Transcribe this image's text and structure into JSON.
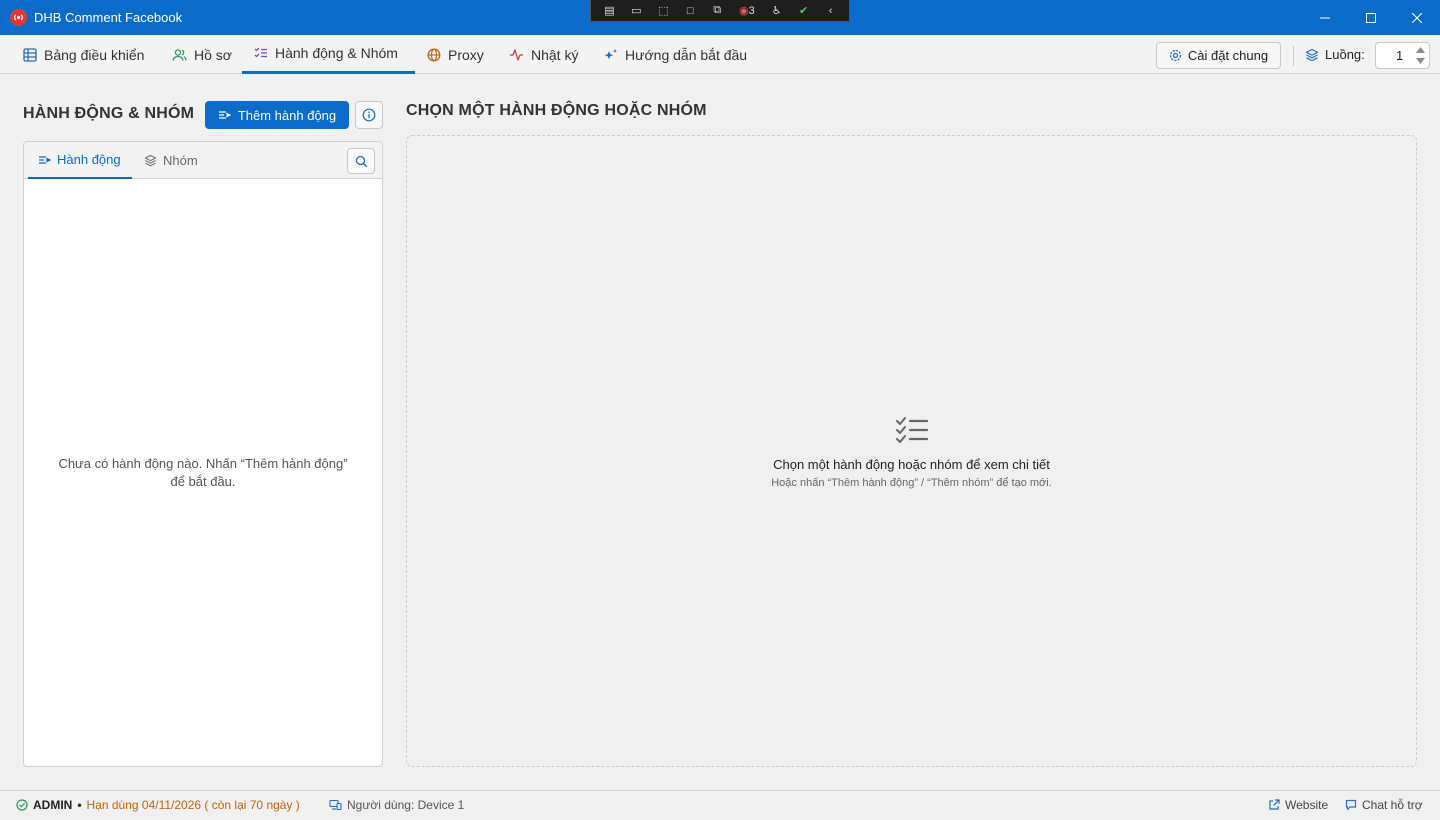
{
  "window": {
    "title": "DHB Comment Facebook",
    "debug_toolbar": {
      "badge_count": "3"
    }
  },
  "tabs": [
    {
      "label": "Bảng điều khiển",
      "icon": "table-icon",
      "active": false
    },
    {
      "label": "Hồ sơ",
      "icon": "users-icon",
      "active": false
    },
    {
      "label": "Hành động & Nhóm",
      "icon": "checklist-icon",
      "active": true
    },
    {
      "label": "Proxy",
      "icon": "globe-icon",
      "active": false
    },
    {
      "label": "Nhật ký",
      "icon": "activity-icon",
      "active": false
    },
    {
      "label": "Hướng dẫn bắt đầu",
      "icon": "sparkles-icon",
      "active": false
    }
  ],
  "toolbar": {
    "settings_label": "Cài đặt chung",
    "threads_label": "Luồng:",
    "threads_value": "1"
  },
  "left": {
    "header": "HÀNH ĐỘNG & NHÓM",
    "add_button_label": "Thêm hành động",
    "subtabs": [
      {
        "label": "Hành động",
        "active": true
      },
      {
        "label": "Nhóm",
        "active": false
      }
    ],
    "empty_text": "Chưa có hành động nào. Nhấn “Thêm hành động” để bắt đầu."
  },
  "right": {
    "header": "CHỌN MỘT HÀNH ĐỘNG HOẶC NHÓM",
    "empty_title": "Chọn một hành động hoặc nhóm để xem chi tiết",
    "empty_subtitle": "Hoặc nhấn “Thêm hành động” / “Thêm nhóm” để tạo mới."
  },
  "status": {
    "user_role": "ADMIN",
    "separator": "•",
    "expiry": "Hạn dùng 04/11/2026 ( còn lại 70 ngày )",
    "device_user": "Người dùng: Device 1",
    "website_label": "Website",
    "support_label": "Chat hỗ trợ"
  },
  "colors": {
    "accent": "#0a6cc8",
    "expiry": "#c0640c",
    "app_icon": "#e53935"
  }
}
